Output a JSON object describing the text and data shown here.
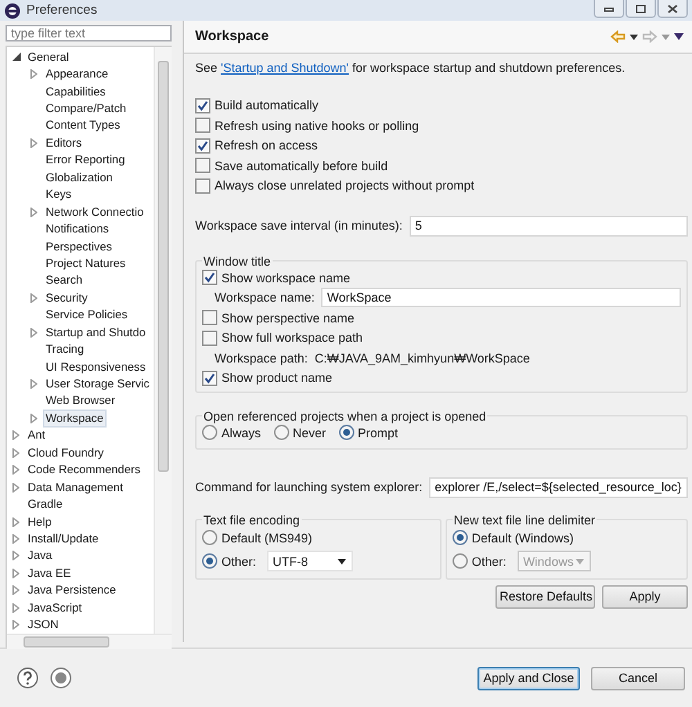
{
  "window": {
    "title": "Preferences"
  },
  "filter": {
    "placeholder": "type filter text"
  },
  "tree": [
    {
      "label": "General",
      "expanded": true,
      "selected": false,
      "children": [
        {
          "label": "Appearance",
          "expanded": false,
          "selected": false
        },
        {
          "label": "Capabilities",
          "selected": false
        },
        {
          "label": "Compare/Patch",
          "selected": false
        },
        {
          "label": "Content Types",
          "selected": false
        },
        {
          "label": "Editors",
          "expanded": false,
          "selected": false
        },
        {
          "label": "Error Reporting",
          "selected": false
        },
        {
          "label": "Globalization",
          "selected": false
        },
        {
          "label": "Keys",
          "selected": false
        },
        {
          "label": "Network Connectio",
          "expanded": false,
          "selected": false
        },
        {
          "label": "Notifications",
          "selected": false
        },
        {
          "label": "Perspectives",
          "selected": false
        },
        {
          "label": "Project Natures",
          "selected": false
        },
        {
          "label": "Search",
          "selected": false
        },
        {
          "label": "Security",
          "expanded": false,
          "selected": false
        },
        {
          "label": "Service Policies",
          "selected": false
        },
        {
          "label": "Startup and Shutdo",
          "expanded": false,
          "selected": false
        },
        {
          "label": "Tracing",
          "selected": false
        },
        {
          "label": "UI Responsiveness",
          "selected": false
        },
        {
          "label": "User Storage Servic",
          "expanded": false,
          "selected": false
        },
        {
          "label": "Web Browser",
          "selected": false
        },
        {
          "label": "Workspace",
          "expanded": false,
          "selected": true
        }
      ]
    },
    {
      "label": "Ant",
      "expanded": false,
      "selected": false
    },
    {
      "label": "Cloud Foundry",
      "expanded": false,
      "selected": false
    },
    {
      "label": "Code Recommenders",
      "expanded": false,
      "selected": false
    },
    {
      "label": "Data Management",
      "expanded": false,
      "selected": false
    },
    {
      "label": "Gradle",
      "selected": false
    },
    {
      "label": "Help",
      "expanded": false,
      "selected": false
    },
    {
      "label": "Install/Update",
      "expanded": false,
      "selected": false
    },
    {
      "label": "Java",
      "expanded": false,
      "selected": false
    },
    {
      "label": "Java EE",
      "expanded": false,
      "selected": false
    },
    {
      "label": "Java Persistence",
      "expanded": false,
      "selected": false
    },
    {
      "label": "JavaScript",
      "expanded": false,
      "selected": false
    },
    {
      "label": "JSON",
      "expanded": false,
      "selected": false
    }
  ],
  "page": {
    "title": "Workspace",
    "nav": {
      "back_enabled": true,
      "forward_enabled": false
    },
    "intro": {
      "before": "See",
      "link": "'Startup and Shutdown'",
      "after": "for workspace startup and shutdown preferences."
    },
    "checkboxes": [
      {
        "label": "Build automatically",
        "checked": true
      },
      {
        "label": "Refresh using native hooks or polling",
        "checked": false
      },
      {
        "label": "Refresh on access",
        "checked": true
      },
      {
        "label": "Save automatically before build",
        "checked": false
      },
      {
        "label": "Always close unrelated projects without prompt",
        "checked": false
      }
    ],
    "save_interval": {
      "label": "Workspace save interval (in minutes):",
      "value": "5"
    },
    "window_title": {
      "title": "Window title",
      "items": [
        {
          "kind": "checkbox",
          "label": "Show workspace name",
          "checked": true
        },
        {
          "kind": "field",
          "label": "Workspace name:",
          "value": "WorkSpace"
        },
        {
          "kind": "checkbox",
          "label": "Show perspective name",
          "checked": false
        },
        {
          "kind": "checkbox",
          "label": "Show full workspace path",
          "checked": false
        },
        {
          "kind": "text",
          "label": "Workspace path:",
          "value": "C:₩JAVA_9AM_kimhyun₩WorkSpace"
        },
        {
          "kind": "checkbox",
          "label": "Show product name",
          "checked": true
        }
      ]
    },
    "open_referenced": {
      "title": "Open referenced projects when a project is opened",
      "options": [
        {
          "label": "Always",
          "selected": false
        },
        {
          "label": "Never",
          "selected": false
        },
        {
          "label": "Prompt",
          "selected": true
        }
      ]
    },
    "command": {
      "label": "Command for launching system explorer:",
      "value": "explorer /E,/select=${selected_resource_loc}"
    },
    "encoding": {
      "title": "Text file encoding",
      "options": [
        {
          "label": "Default (MS949)",
          "selected": false
        },
        {
          "label": "Other:",
          "selected": true,
          "dropdown": {
            "value": "UTF-8",
            "disabled": false
          }
        }
      ]
    },
    "delimiter": {
      "title": "New text file line delimiter",
      "options": [
        {
          "label": "Default (Windows)",
          "selected": true
        },
        {
          "label": "Other:",
          "selected": false,
          "dropdown": {
            "value": "Windows",
            "disabled": true
          }
        }
      ]
    },
    "buttons": [
      "Restore Defaults",
      "Apply"
    ]
  },
  "dialog_buttons": [
    {
      "label": "Apply and Close",
      "default": true
    },
    {
      "label": "Cancel",
      "default": false
    }
  ]
}
